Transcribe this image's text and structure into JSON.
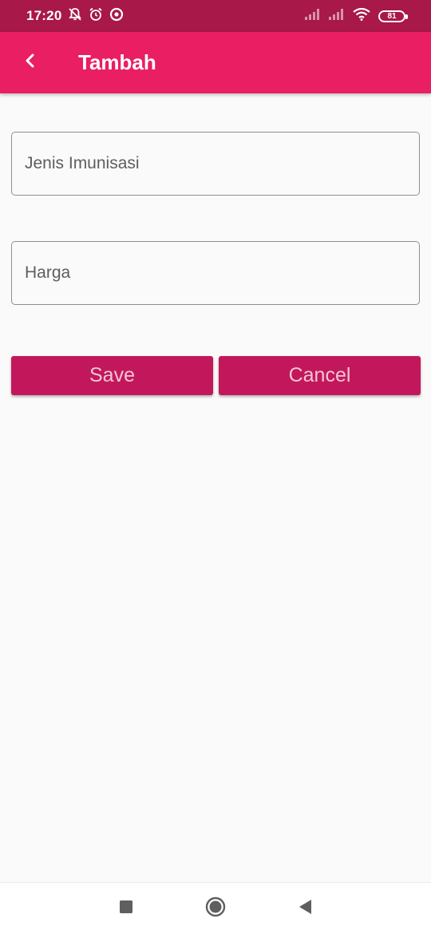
{
  "status_bar": {
    "time": "17:20",
    "battery_level": "81",
    "icons": [
      "notification-off-icon",
      "alarm-icon",
      "location-icon",
      "signal-icon",
      "signal-icon",
      "wifi-icon",
      "battery-icon"
    ]
  },
  "app_bar": {
    "title": "Tambah",
    "back_icon": "back-arrow-icon",
    "color": "#e91e63"
  },
  "form": {
    "jenis_imunisasi": {
      "placeholder": "Jenis Imunisasi",
      "value": ""
    },
    "harga": {
      "placeholder": "Harga",
      "value": ""
    }
  },
  "actions": {
    "save_label": "Save",
    "cancel_label": "Cancel",
    "button_color": "#c2185b"
  },
  "navigation": {
    "items": [
      "recents-icon",
      "home-icon",
      "back-icon"
    ]
  }
}
